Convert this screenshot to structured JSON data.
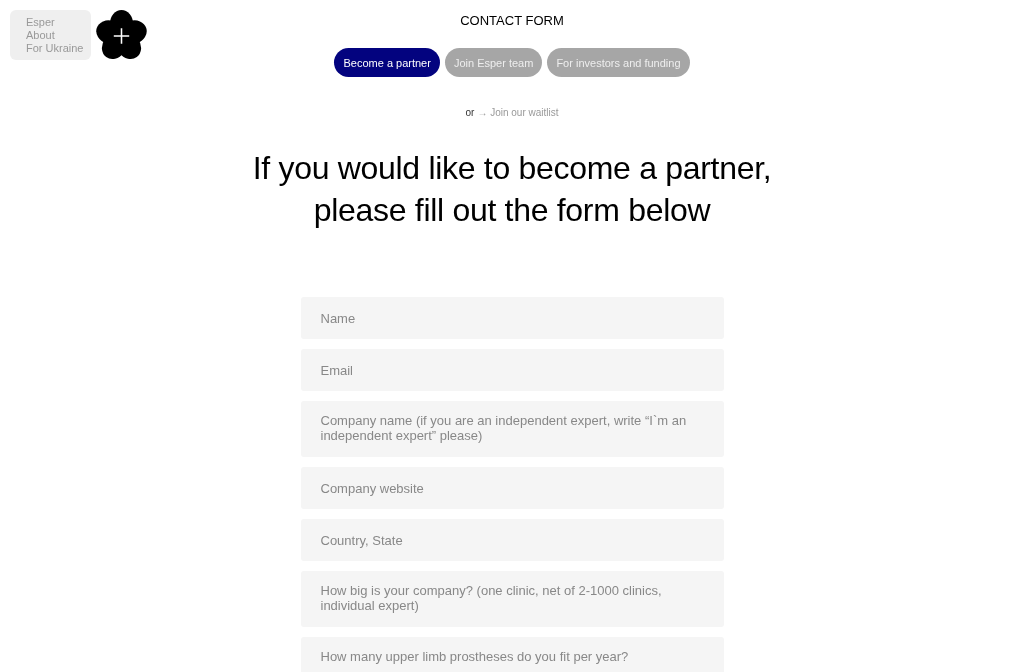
{
  "menu": {
    "items": [
      "Esper",
      "About",
      "For Ukraine"
    ]
  },
  "title": "CONTACT FORM",
  "tabs": [
    {
      "label": "Become a partner",
      "selected": true
    },
    {
      "label": "Join Esper team",
      "selected": false
    },
    {
      "label": "For investors and funding",
      "selected": false
    }
  ],
  "waitlist": {
    "prefix": "or",
    "link": "→ Join our waitlist"
  },
  "heading": "If you would like to become a partner, please fill out the form below",
  "fields": [
    {
      "placeholder": "Name",
      "kind": "line"
    },
    {
      "placeholder": "Email",
      "kind": "line"
    },
    {
      "placeholder": "Company name (if you are an independent expert, write “I`m an independent expert” please)",
      "kind": "multi"
    },
    {
      "placeholder": "Company website",
      "kind": "line"
    },
    {
      "placeholder": "Country, State",
      "kind": "line"
    },
    {
      "placeholder": "How big is your company? (one clinic, net of 2-1000 clinics, individual expert)",
      "kind": "multi"
    },
    {
      "placeholder": "How many upper limb prostheses do you fit per year?",
      "kind": "multi"
    }
  ]
}
